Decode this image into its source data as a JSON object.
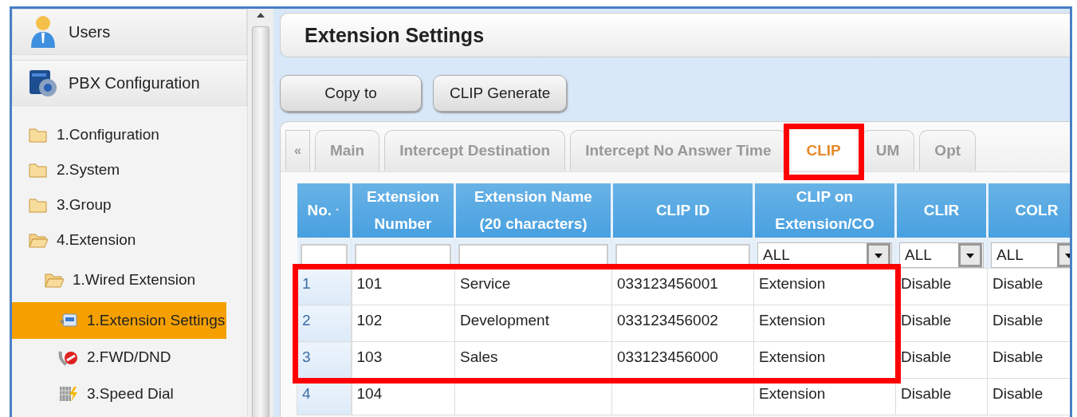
{
  "sidebar": {
    "panels": [
      {
        "label": "Users",
        "kind": "user"
      },
      {
        "label": "PBX Configuration",
        "kind": "pbx"
      }
    ],
    "tree": [
      {
        "label": "1.Configuration",
        "kind": "folder",
        "expanded": false,
        "selected": false
      },
      {
        "label": "2.System",
        "kind": "folder",
        "expanded": false,
        "selected": false
      },
      {
        "label": "3.Group",
        "kind": "folder",
        "expanded": false,
        "selected": false
      },
      {
        "label": "4.Extension",
        "kind": "folder",
        "expanded": true,
        "selected": false,
        "children": [
          {
            "label": "1.Wired Extension",
            "kind": "folder",
            "expanded": true,
            "selected": false,
            "children": [
              {
                "label": "1.Extension Settings",
                "kind": "settings",
                "selected": true
              },
              {
                "label": "2.FWD/DND",
                "kind": "forward",
                "selected": false
              },
              {
                "label": "3.Speed Dial",
                "kind": "speed",
                "selected": false
              }
            ]
          }
        ]
      }
    ]
  },
  "main": {
    "title": "Extension Settings",
    "buttons": [
      "Copy to",
      "CLIP Generate"
    ],
    "tab_scroll": "«",
    "tabs": [
      {
        "label": "Main",
        "selected": false,
        "highlighted": false
      },
      {
        "label": "Intercept Destination",
        "selected": false,
        "highlighted": false
      },
      {
        "label": "Intercept No Answer Time",
        "selected": false,
        "highlighted": false
      },
      {
        "label": "CLIP",
        "selected": true,
        "highlighted": true
      },
      {
        "label": "UM",
        "selected": false,
        "highlighted": false
      },
      {
        "label": "Opt",
        "selected": false,
        "highlighted": false
      }
    ],
    "table": {
      "columns": [
        {
          "label": "No.",
          "sorted": true
        },
        {
          "label": "Extension\nNumber",
          "sorted": false
        },
        {
          "label": "Extension Name\n(20 characters)",
          "sorted": false
        },
        {
          "label": "CLIP ID",
          "sorted": false
        },
        {
          "label": "CLIP on\nExtension/CO",
          "sorted": false
        },
        {
          "label": "CLIR",
          "sorted": false
        },
        {
          "label": "COLR",
          "sorted": false
        }
      ],
      "filters": [
        {
          "kind": "text"
        },
        {
          "kind": "text"
        },
        {
          "kind": "text"
        },
        {
          "kind": "text"
        },
        {
          "kind": "select",
          "value": "ALL"
        },
        {
          "kind": "select",
          "value": "ALL"
        },
        {
          "kind": "select",
          "value": "ALL"
        }
      ],
      "rows": [
        {
          "highlighted": true,
          "cells": [
            "1",
            "101",
            "Service",
            "033123456001",
            "Extension",
            "Disable",
            "Disable"
          ]
        },
        {
          "highlighted": true,
          "cells": [
            "2",
            "102",
            "Development",
            "033123456002",
            "Extension",
            "Disable",
            "Disable"
          ]
        },
        {
          "highlighted": true,
          "cells": [
            "3",
            "103",
            "Sales",
            "033123456000",
            "Extension",
            "Disable",
            "Disable"
          ]
        },
        {
          "highlighted": false,
          "cells": [
            "4",
            "104",
            "",
            "",
            "Extension",
            "Disable",
            "Disable"
          ]
        }
      ]
    }
  }
}
